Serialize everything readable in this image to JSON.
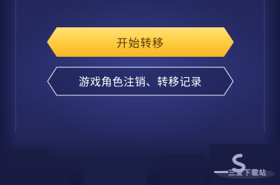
{
  "buttons": {
    "start_transfer": "开始转移",
    "records": "游戏角色注销、转移记录"
  },
  "watermark": {
    "text": "三爱下载站"
  },
  "colors": {
    "background": "#23275c",
    "primary_button": "#ffcf45",
    "primary_text": "#5a3a0c",
    "outline": "#c9cde8"
  }
}
